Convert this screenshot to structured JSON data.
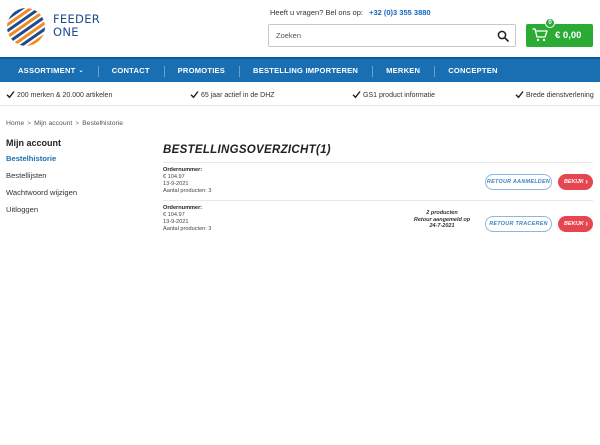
{
  "brand": {
    "line1": "FEEDER",
    "line2": "ONE",
    "colors": {
      "blue": "#1e4b8c",
      "orange": "#f08a24"
    }
  },
  "header": {
    "contact_text": "Heeft u vragen? Bel ons op:",
    "phone": "+32 (0)3 355 3880",
    "search_placeholder": "Zoeken",
    "search_icon": "search-icon",
    "cart": {
      "badge": "0",
      "amount": "€ 0,00",
      "color": "#2bab34"
    }
  },
  "nav": {
    "color": "#1a6fb3",
    "items": [
      {
        "label": "ASSORTIMENT",
        "has_dropdown": true
      },
      {
        "label": "CONTACT"
      },
      {
        "label": "PROMOTIES"
      },
      {
        "label": "BESTELLING IMPORTEREN"
      },
      {
        "label": "MERKEN"
      },
      {
        "label": "CONCEPTEN"
      }
    ]
  },
  "usp": [
    "200 merken & 20.000 artikelen",
    "65 jaar actief in de DHZ",
    "GS1 product informatie",
    "Brede dienstverlening"
  ],
  "breadcrumb": [
    "Home",
    "Mijn account",
    "Bestelhistorie"
  ],
  "sidebar": {
    "title": "Mijn account",
    "items": [
      {
        "label": "Bestelhistorie",
        "active": true
      },
      {
        "label": "Bestellijsten"
      },
      {
        "label": "Wachtwoord wijzigen"
      },
      {
        "label": "Uitloggen"
      }
    ]
  },
  "main": {
    "title": "BESTELLINGSOVERZICHT(1)",
    "orders": [
      {
        "label": "Ordernummer:",
        "price": "€ 104.97",
        "date": "13-9-2021",
        "count": "Aantal producten: 3",
        "note": [],
        "secondary_button": "RETOUR AANMELDEN",
        "primary_button": "BEKIJK"
      },
      {
        "label": "Ordernummer:",
        "price": "€ 104.97",
        "date": "13-9-2021",
        "count": "Aantal producten: 3",
        "note": [
          "2 producten",
          "Retour aangemeld op",
          "24-7-2021"
        ],
        "secondary_button": "RETOUR TRACEREN",
        "primary_button": "BEKIJK"
      }
    ]
  }
}
